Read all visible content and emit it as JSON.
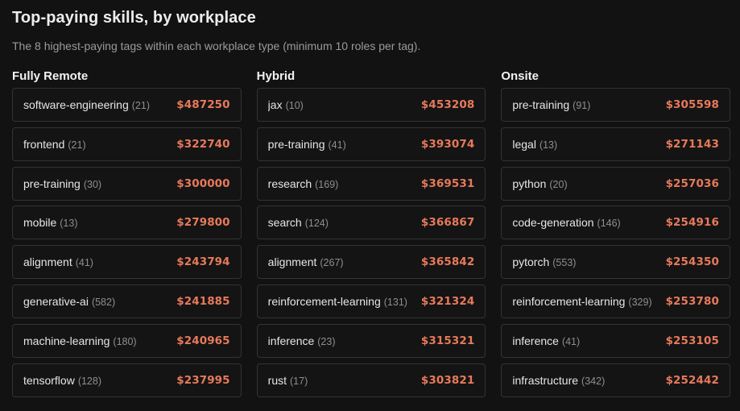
{
  "header": {
    "title": "Top-paying skills, by workplace",
    "subtitle": "The 8 highest-paying tags within each workplace type (minimum 10 roles per tag)."
  },
  "colors": {
    "background": "#121212",
    "salary_accent": "#e8795b",
    "row_border": "#333333"
  },
  "columns": [
    {
      "heading": "Fully Remote",
      "rows": [
        {
          "tag": "software-engineering",
          "count": "(21)",
          "salary": "$487250"
        },
        {
          "tag": "frontend",
          "count": "(21)",
          "salary": "$322740"
        },
        {
          "tag": "pre-training",
          "count": "(30)",
          "salary": "$300000"
        },
        {
          "tag": "mobile",
          "count": "(13)",
          "salary": "$279800"
        },
        {
          "tag": "alignment",
          "count": "(41)",
          "salary": "$243794"
        },
        {
          "tag": "generative-ai",
          "count": "(582)",
          "salary": "$241885"
        },
        {
          "tag": "machine-learning",
          "count": "(180)",
          "salary": "$240965"
        },
        {
          "tag": "tensorflow",
          "count": "(128)",
          "salary": "$237995"
        }
      ]
    },
    {
      "heading": "Hybrid",
      "rows": [
        {
          "tag": "jax",
          "count": "(10)",
          "salary": "$453208"
        },
        {
          "tag": "pre-training",
          "count": "(41)",
          "salary": "$393074"
        },
        {
          "tag": "research",
          "count": "(169)",
          "salary": "$369531"
        },
        {
          "tag": "search",
          "count": "(124)",
          "salary": "$366867"
        },
        {
          "tag": "alignment",
          "count": "(267)",
          "salary": "$365842"
        },
        {
          "tag": "reinforcement-learning",
          "count": "(131)",
          "salary": "$321324"
        },
        {
          "tag": "inference",
          "count": "(23)",
          "salary": "$315321"
        },
        {
          "tag": "rust",
          "count": "(17)",
          "salary": "$303821"
        }
      ]
    },
    {
      "heading": "Onsite",
      "rows": [
        {
          "tag": "pre-training",
          "count": "(91)",
          "salary": "$305598"
        },
        {
          "tag": "legal",
          "count": "(13)",
          "salary": "$271143"
        },
        {
          "tag": "python",
          "count": "(20)",
          "salary": "$257036"
        },
        {
          "tag": "code-generation",
          "count": "(146)",
          "salary": "$254916"
        },
        {
          "tag": "pytorch",
          "count": "(553)",
          "salary": "$254350"
        },
        {
          "tag": "reinforcement-learning",
          "count": "(329)",
          "salary": "$253780"
        },
        {
          "tag": "inference",
          "count": "(41)",
          "salary": "$253105"
        },
        {
          "tag": "infrastructure",
          "count": "(342)",
          "salary": "$252442"
        }
      ]
    }
  ]
}
